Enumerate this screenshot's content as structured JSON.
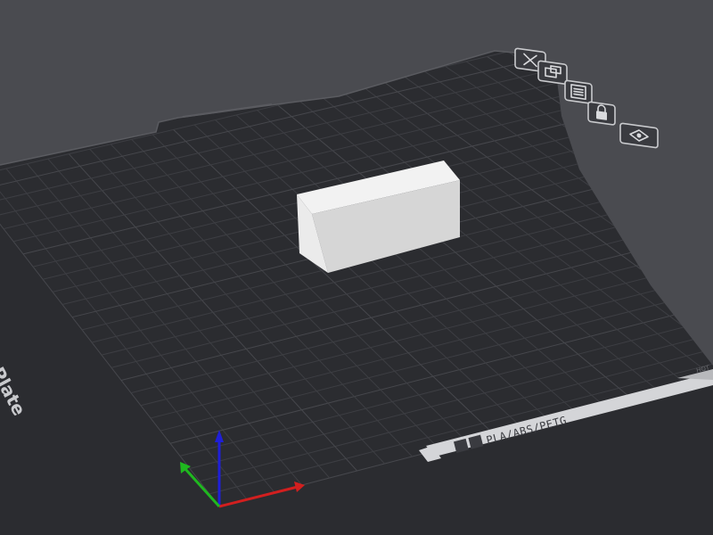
{
  "plate": {
    "name": "Bambu Textured PEI Plate",
    "material_label": "PLA/ABS/PETG",
    "hot_label": "HOT"
  },
  "toolbar": [
    {
      "id": "close",
      "icon": "close-x-icon"
    },
    {
      "id": "arrange",
      "icon": "arrange-icon"
    },
    {
      "id": "plate-settings",
      "icon": "settings-list-icon"
    },
    {
      "id": "lock",
      "icon": "lock-icon"
    },
    {
      "id": "view",
      "icon": "eye-icon"
    }
  ],
  "axes": {
    "x_color": "#d21f1f",
    "y_color": "#1fb81f",
    "z_color": "#1f1fd8"
  },
  "colors": {
    "background": "#4a4b50",
    "plate": "#2b2c30",
    "grid": "#3d3e43",
    "object": "#e8e8e8"
  }
}
